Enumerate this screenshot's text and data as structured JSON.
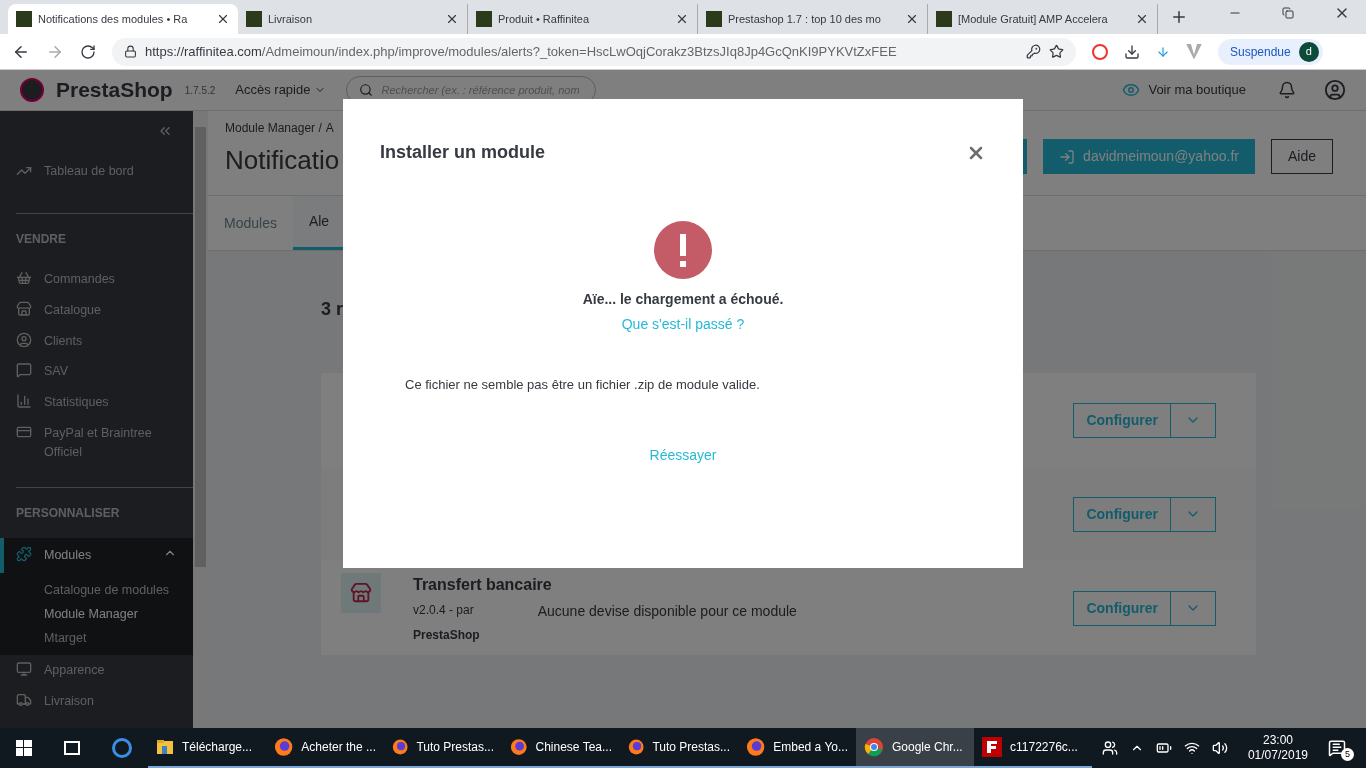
{
  "browser": {
    "tabs": [
      {
        "title": "Notifications des modules • Ra",
        "selected": true
      },
      {
        "title": "Livraison",
        "selected": false
      },
      {
        "title": "Produit • Raffinitea",
        "selected": false
      },
      {
        "title": "Prestashop 1.7 : top 10 des mo",
        "selected": false
      },
      {
        "title": "[Module Gratuit] AMP Accelera",
        "selected": false
      }
    ],
    "url_host": "https://raffinitea.com",
    "url_path": "/Admeimoun/index.php/improve/modules/alerts?_token=HscLwOqjCorakz3BtzsJIq8Jp4GcQnKI9PYKVtZxFEE",
    "profile": "Suspendue",
    "avatar": "d"
  },
  "header": {
    "logo": "PrestaShop",
    "version": "1.7.5.2",
    "quick_access": "Accès rapide",
    "search_placeholder": "Rechercher (ex. : référence produit, nom",
    "view_shop": "Voir ma boutique"
  },
  "sidebar": {
    "dashboard": "Tableau de bord",
    "sections": [
      {
        "title": "VENDRE",
        "items": [
          {
            "label": "Commandes",
            "selected": false
          },
          {
            "label": "Catalogue",
            "selected": false
          },
          {
            "label": "Clients",
            "selected": false
          },
          {
            "label": "SAV",
            "selected": false
          },
          {
            "label": "Statistiques",
            "selected": false
          },
          {
            "label": "PayPal et Braintree Officiel",
            "selected": false
          }
        ]
      },
      {
        "title": "PERSONNALISER",
        "items": [
          {
            "label": "Modules",
            "selected": true,
            "expanded": true,
            "children": [
              {
                "label": "Catalogue de modules",
                "selected": false
              },
              {
                "label": "Module Manager",
                "selected": true
              },
              {
                "label": "Mtarget",
                "selected": false
              }
            ]
          },
          {
            "label": "Apparence",
            "selected": false
          },
          {
            "label": "Livraison",
            "selected": false
          }
        ]
      }
    ]
  },
  "page": {
    "breadcrumb": [
      "Module Manager /",
      "A"
    ],
    "title": "Notificatio",
    "account_button": "davidmeimoun@yahoo.fr",
    "help_button": "Aide",
    "tabs": [
      {
        "label": "Modules",
        "selected": false
      },
      {
        "label": "Ale",
        "selected": true
      }
    ],
    "count": "3 r",
    "modules": [
      {
        "action": "Configurer"
      },
      {
        "action": "Configurer"
      },
      {
        "name": "Transfert bancaire",
        "version": "v2.0.4 - par",
        "author": "PrestaShop",
        "description": "Aucune devise disponible pour ce module",
        "action": "Configurer"
      }
    ]
  },
  "modal": {
    "title": "Installer un module",
    "error_title": "Aïe... le chargement a échoué.",
    "link": "Que s'est-il passé ?",
    "message": "Ce fichier ne semble pas être un fichier .zip de module valide.",
    "retry": "Réessayer"
  },
  "taskbar": {
    "apps": [
      {
        "label": "Télécharge...",
        "kind": "folder",
        "selected": false
      },
      {
        "label": "Acheter the ...",
        "kind": "firefox",
        "selected": false
      },
      {
        "label": "Tuto Prestas...",
        "kind": "firefox",
        "selected": false
      },
      {
        "label": "Chinese Tea...",
        "kind": "firefox",
        "selected": false
      },
      {
        "label": "Tuto Prestas...",
        "kind": "firefox",
        "selected": false
      },
      {
        "label": "Embed a Yo...",
        "kind": "firefox",
        "selected": false
      },
      {
        "label": "Google Chr...",
        "kind": "chrome",
        "selected": true
      },
      {
        "label": "c1172276c...",
        "kind": "filezilla",
        "selected": false
      }
    ],
    "time": "23:00",
    "date": "01/07/2019",
    "notifications": "5"
  }
}
